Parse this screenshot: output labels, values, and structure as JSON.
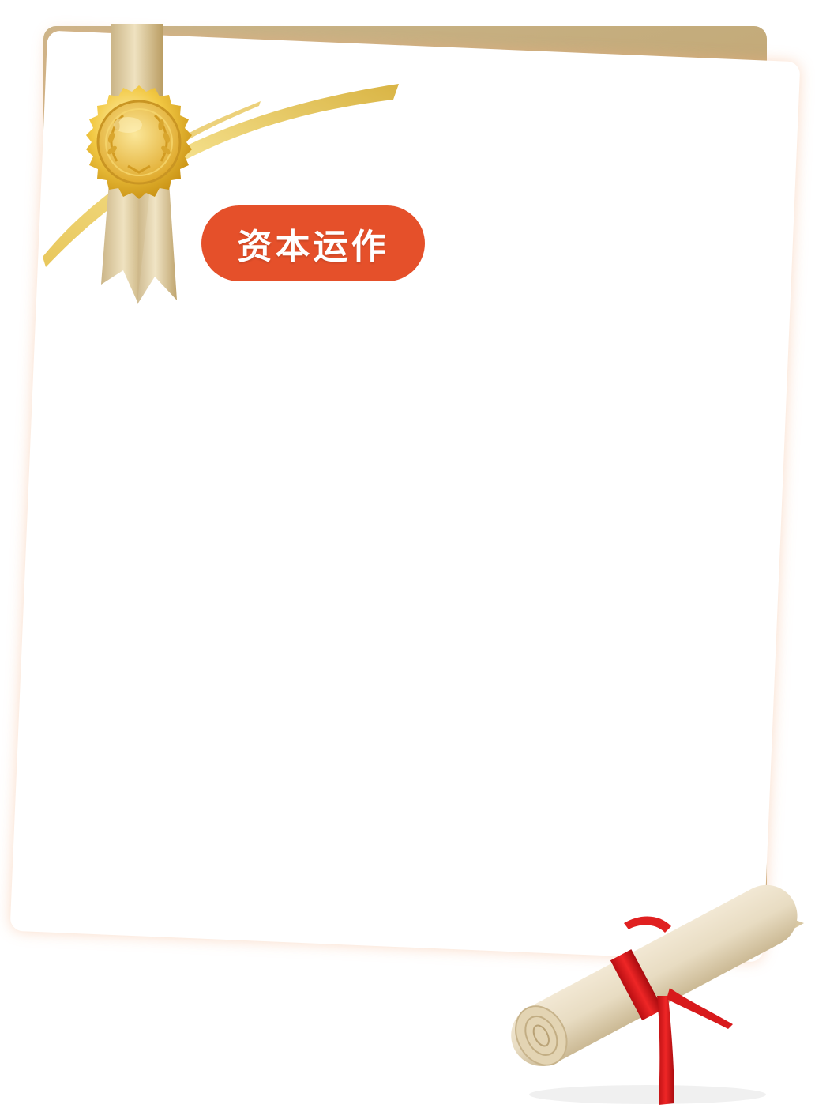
{
  "tag": {
    "label": "资本运作"
  },
  "colors": {
    "tag_background": "#e5502a",
    "board_gold": "#bfa26c",
    "paper": "#ffffff",
    "ribbon_red": "#e01b1b"
  },
  "icons": [
    "gold-medal-seal-icon",
    "gold-ribbon-icon",
    "diploma-scroll-icon"
  ]
}
